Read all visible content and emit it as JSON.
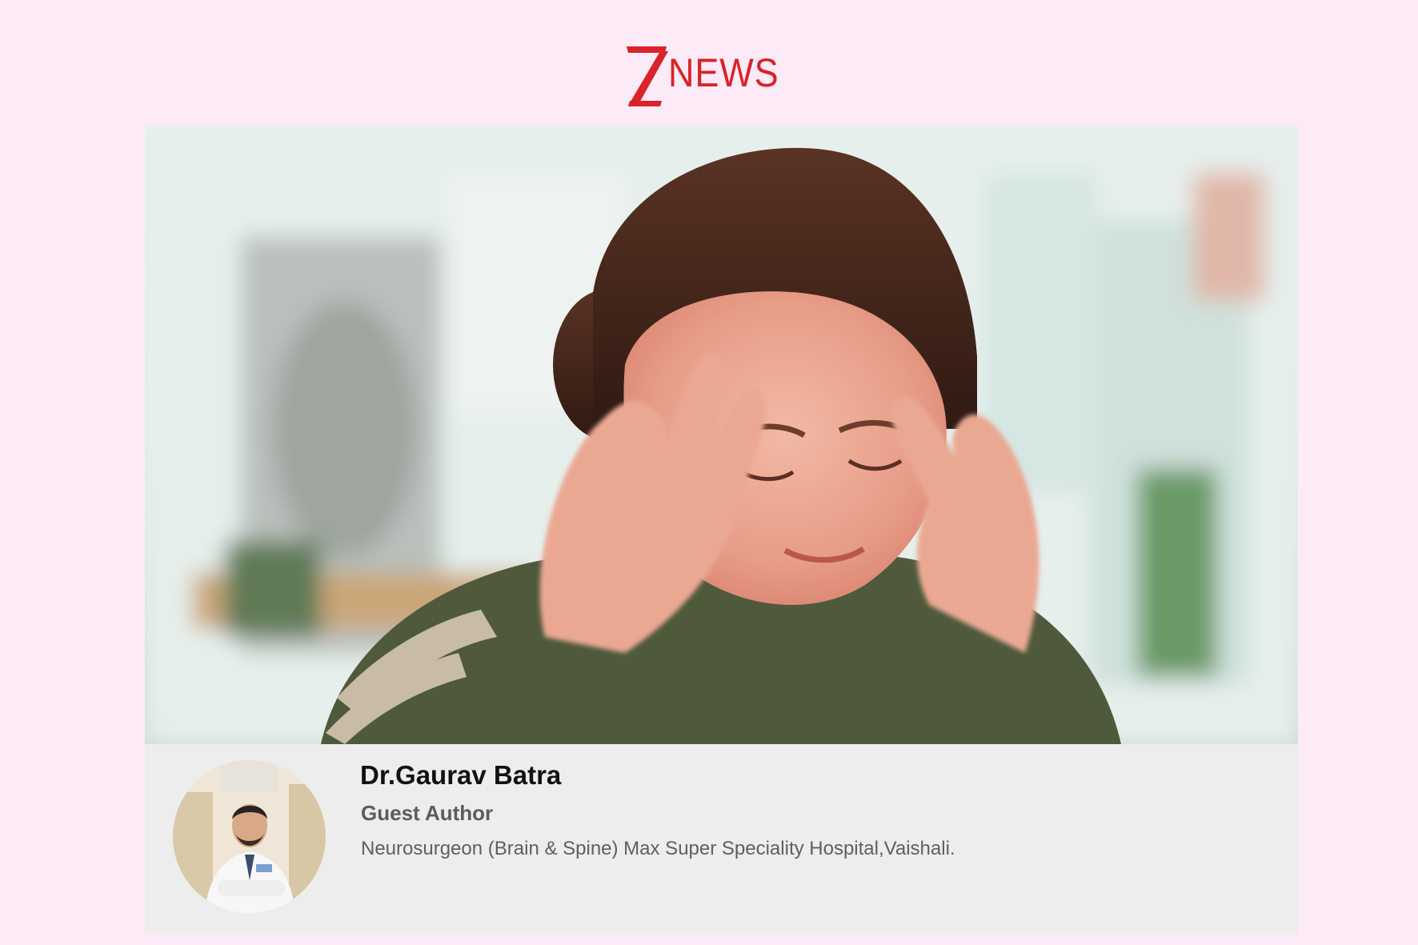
{
  "brand": {
    "logo_letter": "Z",
    "logo_text": "NEWS",
    "accent_color": "#d8232a",
    "background_color": "#fcebf6"
  },
  "hero": {
    "icon": "hero-image"
  },
  "author": {
    "name": "Dr.Gaurav Batra",
    "role": "Guest Author",
    "bio": "Neurosurgeon (Brain & Spine) Max Super Speciality Hospital,Vaishali.",
    "avatar_icon": "author-avatar"
  }
}
